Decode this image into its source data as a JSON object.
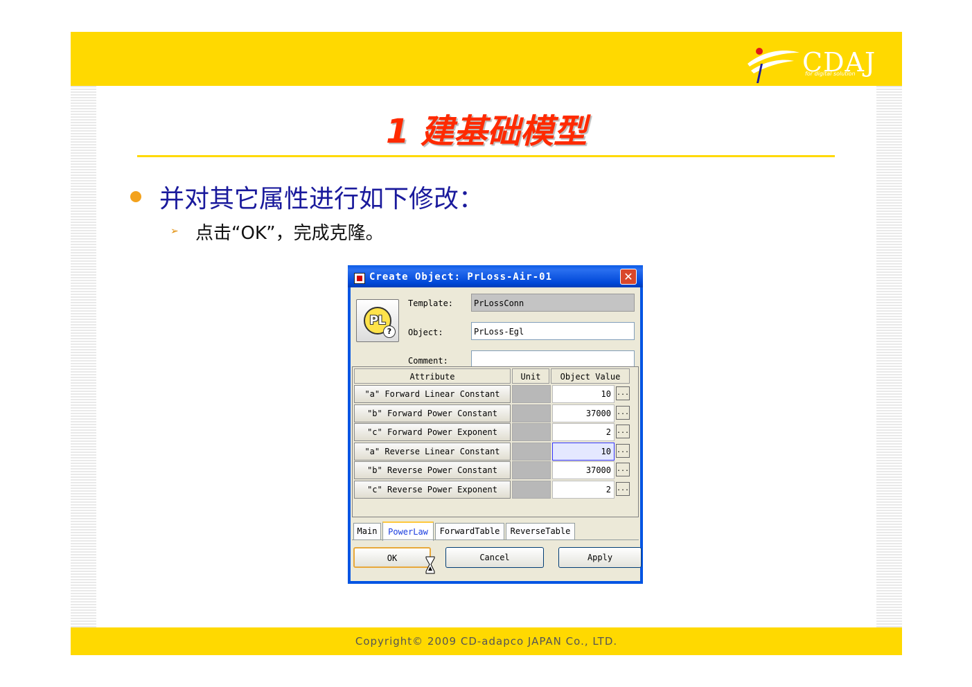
{
  "slide": {
    "title": "1 建基础模型",
    "bullet": "并对其它属性进行如下修改：",
    "sub_bullet": "点击“OK”，完成克隆。",
    "sub_arrow": "➢",
    "copyright": "Copyright© 2009 CD-adapco JAPAN Co., LTD.",
    "logo_text": "CDAJ",
    "logo_tagline": "for digital solution"
  },
  "colors": {
    "banner": "#ffd900",
    "title": "#ff2a00",
    "bullet_text": "#1a1a9c",
    "bullet_dot": "#f3a21d",
    "dialog_titlebar": "#0054e3"
  },
  "dialog": {
    "title": "Create Object: PrLoss-Air-01",
    "close_glyph": "✕",
    "icon_text": "PL",
    "icon_badge": "?",
    "template_label": "Template:",
    "template_value": "PrLossConn",
    "object_label": "Object:",
    "object_value": "PrLoss-Egl",
    "comment_label": "Comment:",
    "comment_value": "",
    "columns": [
      "Attribute",
      "Unit",
      "Object Value"
    ],
    "rows": [
      {
        "attribute": "\"a\" Forward Linear Constant",
        "unit": "",
        "value": "10",
        "selected": false
      },
      {
        "attribute": "\"b\" Forward Power Constant",
        "unit": "",
        "value": "37000",
        "selected": false
      },
      {
        "attribute": "\"c\" Forward Power Exponent",
        "unit": "",
        "value": "2",
        "selected": false
      },
      {
        "attribute": "\"a\" Reverse Linear Constant",
        "unit": "",
        "value": "10",
        "selected": true
      },
      {
        "attribute": "\"b\" Reverse Power Constant",
        "unit": "",
        "value": "37000",
        "selected": false
      },
      {
        "attribute": "\"c\" Reverse Power Exponent",
        "unit": "",
        "value": "2",
        "selected": false
      }
    ],
    "browse_label": "...",
    "tabs": [
      "Main",
      "PowerLaw",
      "ForwardTable",
      "ReverseTable"
    ],
    "active_tab": "PowerLaw",
    "buttons": {
      "ok": "OK",
      "cancel": "Cancel",
      "apply": "Apply"
    }
  }
}
